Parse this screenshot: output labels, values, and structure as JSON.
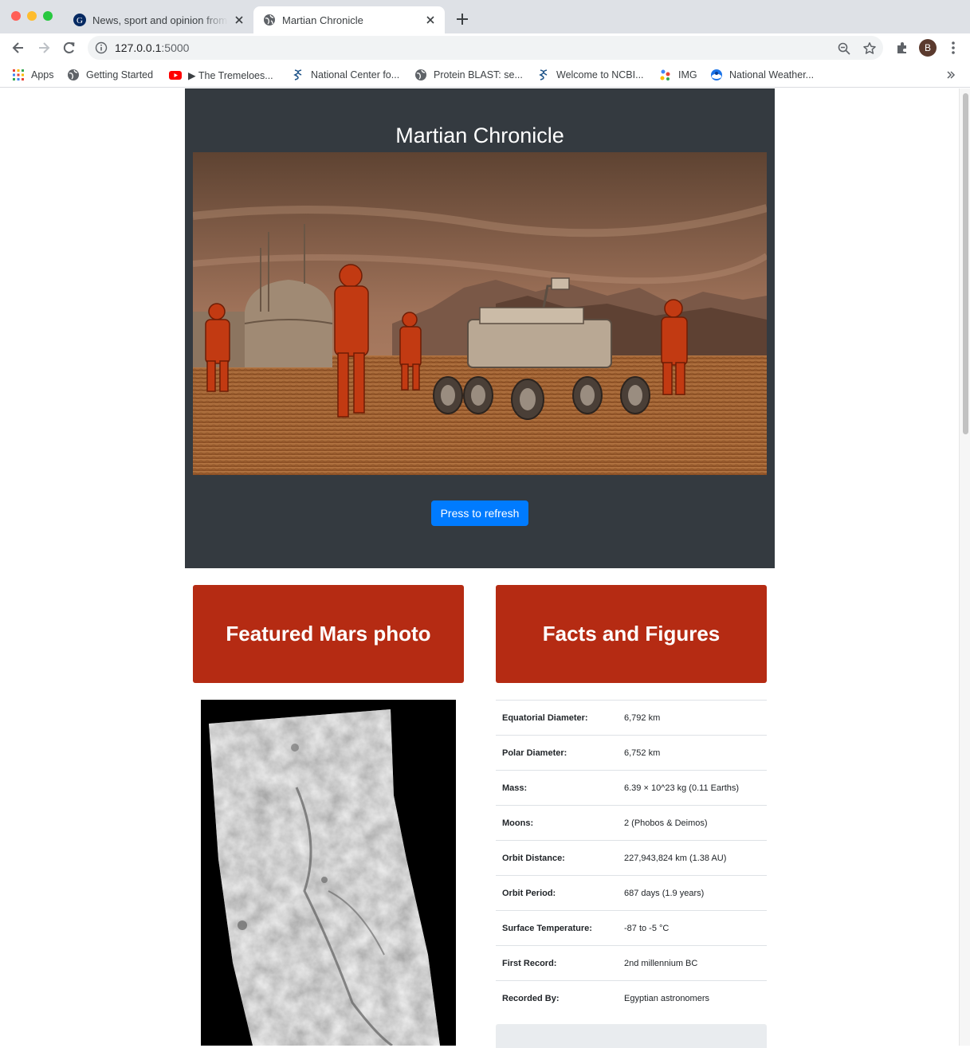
{
  "browser": {
    "tabs": [
      {
        "title": "News, sport and opinion from the Guardian's global edition",
        "active": false
      },
      {
        "title": "Martian Chronicle",
        "active": true
      }
    ],
    "url_host": "127.0.0.1",
    "url_port": ":5000",
    "profile_initial": "B",
    "bookmarks": [
      {
        "label": "Apps",
        "icon": "apps-grid-icon"
      },
      {
        "label": "Getting Started",
        "icon": "globe-icon"
      },
      {
        "label": "▶ The Tremeloes...",
        "icon": "youtube-icon"
      },
      {
        "label": "National Center fo...",
        "icon": "ncbi-icon"
      },
      {
        "label": "Protein BLAST: se...",
        "icon": "globe-icon"
      },
      {
        "label": "Welcome to NCBI...",
        "icon": "ncbi-icon"
      },
      {
        "label": "IMG",
        "icon": "img-dots-icon"
      },
      {
        "label": "National Weather...",
        "icon": "noaa-icon"
      }
    ]
  },
  "page": {
    "title": "Martian Chronicle",
    "refresh_button": "Press to refresh",
    "featured_header": "Featured Mars photo",
    "facts_header": "Facts and Figures",
    "facts": [
      {
        "label": "Equatorial Diameter:",
        "value": "6,792 km"
      },
      {
        "label": "Polar Diameter:",
        "value": "6,752 km"
      },
      {
        "label": "Mass:",
        "value": "6.39 × 10^23 kg (0.11 Earths)"
      },
      {
        "label": "Moons:",
        "value": "2 (Phobos & Deimos)"
      },
      {
        "label": "Orbit Distance:",
        "value": "227,943,824 km (1.38 AU)"
      },
      {
        "label": "Orbit Period:",
        "value": "687 days (1.9 years)"
      },
      {
        "label": "Surface Temperature:",
        "value": "-87 to -5 °C"
      },
      {
        "label": "First Record:",
        "value": "2nd millennium BC"
      },
      {
        "label": "Recorded By:",
        "value": "Egyptian astronomers"
      }
    ]
  },
  "colors": {
    "jumbotron": "#343a40",
    "accent_red": "#b52b13",
    "button_blue": "#007bff"
  }
}
